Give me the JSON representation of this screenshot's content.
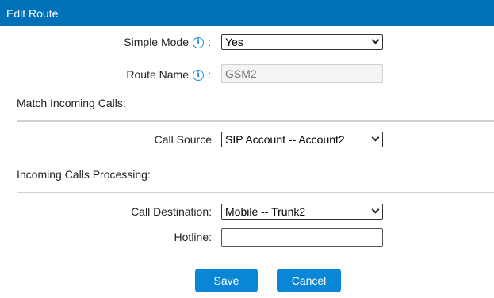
{
  "window": {
    "title": "Edit Route"
  },
  "form": {
    "simple_mode": {
      "label": "Simple Mode",
      "colon": ":",
      "value": "Yes"
    },
    "route_name": {
      "label": "Route Name",
      "colon": ":",
      "value": "GSM2"
    },
    "match_section": {
      "title": "Match Incoming Calls:"
    },
    "call_source": {
      "label": "Call Source",
      "value": "SIP Account -- Account2"
    },
    "processing_section": {
      "title": "Incoming Calls Processing:"
    },
    "call_destination": {
      "label": "Call Destination:",
      "value": "Mobile -- Trunk2"
    },
    "hotline": {
      "label": "Hotline:",
      "value": ""
    }
  },
  "buttons": {
    "save": "Save",
    "cancel": "Cancel"
  },
  "icons": {
    "info": "info-icon",
    "dropdown": "chevron-down-icon"
  },
  "colors": {
    "header": "#0070b8",
    "button": "#0a86d6",
    "info_icon": "#1f8fd6"
  }
}
